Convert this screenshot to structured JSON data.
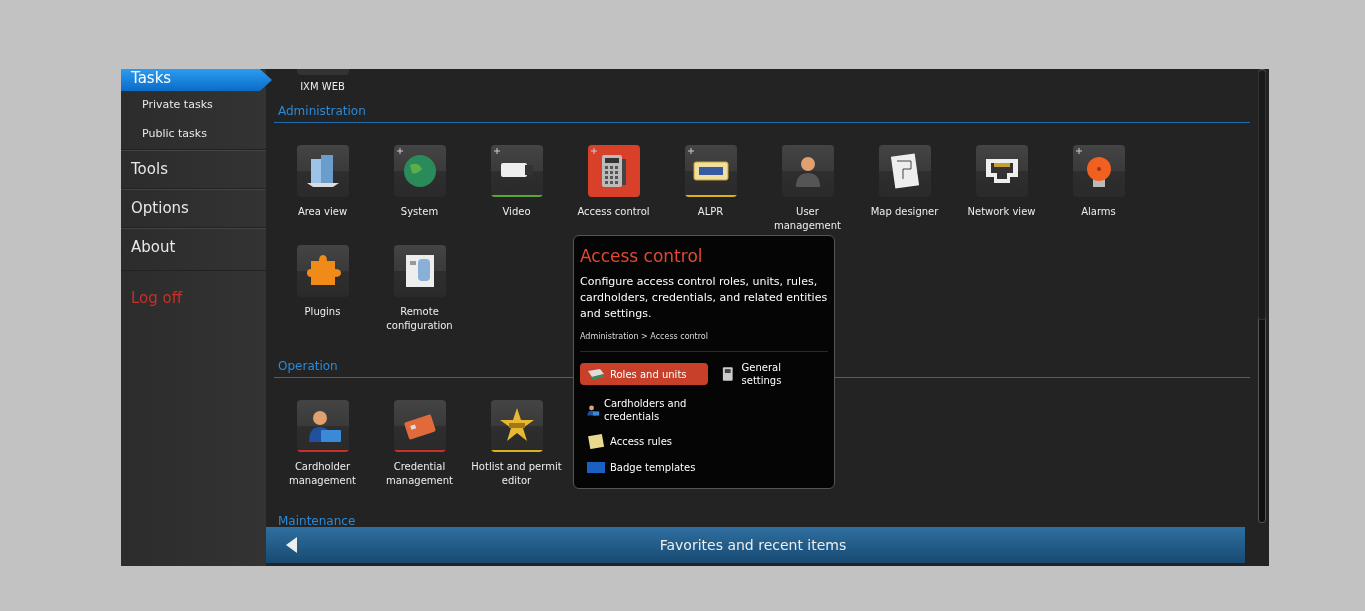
{
  "sidebar": {
    "items": [
      {
        "label": "Tasks",
        "kind": "header",
        "selected": true
      },
      {
        "label": "Private tasks",
        "kind": "sub",
        "selected": false
      },
      {
        "label": "Public tasks",
        "kind": "sub",
        "selected": false
      },
      {
        "label": "Tools",
        "kind": "header",
        "selected": false
      },
      {
        "label": "Options",
        "kind": "header",
        "selected": false
      },
      {
        "label": "About",
        "kind": "header",
        "selected": false
      },
      {
        "label": "Log off",
        "kind": "logoff",
        "selected": false
      }
    ]
  },
  "top_tile": {
    "label": "IXM WEB"
  },
  "sections": [
    {
      "title": "Administration",
      "tiles": [
        {
          "label": "Area view",
          "kind": "building",
          "plus": false,
          "selected": false
        },
        {
          "label": "System",
          "kind": "globe",
          "plus": true,
          "selected": false
        },
        {
          "label": "Video",
          "kind": "camera",
          "plus": true,
          "selected": false,
          "color": "#5aa832"
        },
        {
          "label": "Access control",
          "kind": "keypad",
          "plus": true,
          "selected": true
        },
        {
          "label": "ALPR",
          "kind": "plate",
          "plus": true,
          "selected": false,
          "color": "#d8b020"
        },
        {
          "label": "User management",
          "kind": "person",
          "plus": false,
          "selected": false
        },
        {
          "label": "Map designer",
          "kind": "map",
          "plus": false,
          "selected": false
        },
        {
          "label": "Network view",
          "kind": "network",
          "plus": false,
          "selected": false
        },
        {
          "label": "Alarms",
          "kind": "bell",
          "plus": true,
          "selected": false
        },
        {
          "label": "Plugins",
          "kind": "puzzle",
          "plus": false,
          "selected": false
        },
        {
          "label": "Remote configuration",
          "kind": "remote",
          "plus": false,
          "selected": false
        }
      ]
    },
    {
      "title": "Operation",
      "tiles": [
        {
          "label": "Cardholder management",
          "kind": "cardholder",
          "plus": false,
          "selected": false,
          "color": "#c8302a"
        },
        {
          "label": "Credential management",
          "kind": "card",
          "plus": false,
          "selected": false,
          "color": "#c8302a"
        },
        {
          "label": "Hotlist and permit editor",
          "kind": "badge",
          "plus": false,
          "selected": false,
          "color": "#d8b020"
        }
      ]
    },
    {
      "title": "Maintenance"
    }
  ],
  "popup": {
    "title": "Access control",
    "description": "Configure access control roles, units, rules, cardholders, credentials, and related entities and settings.",
    "breadcrumb": "Administration > Access control",
    "items": [
      {
        "label": "Roles and units",
        "kind": "roles",
        "selected": true
      },
      {
        "label": "General settings",
        "kind": "settings",
        "selected": false
      },
      {
        "label": "Cardholders and credentials",
        "kind": "cardholder",
        "selected": false
      },
      {
        "label": "Access rules",
        "kind": "rules",
        "selected": false
      },
      {
        "label": "Badge templates",
        "kind": "template",
        "selected": false
      }
    ]
  },
  "bottom_bar": {
    "title": "Favorites and recent items"
  }
}
